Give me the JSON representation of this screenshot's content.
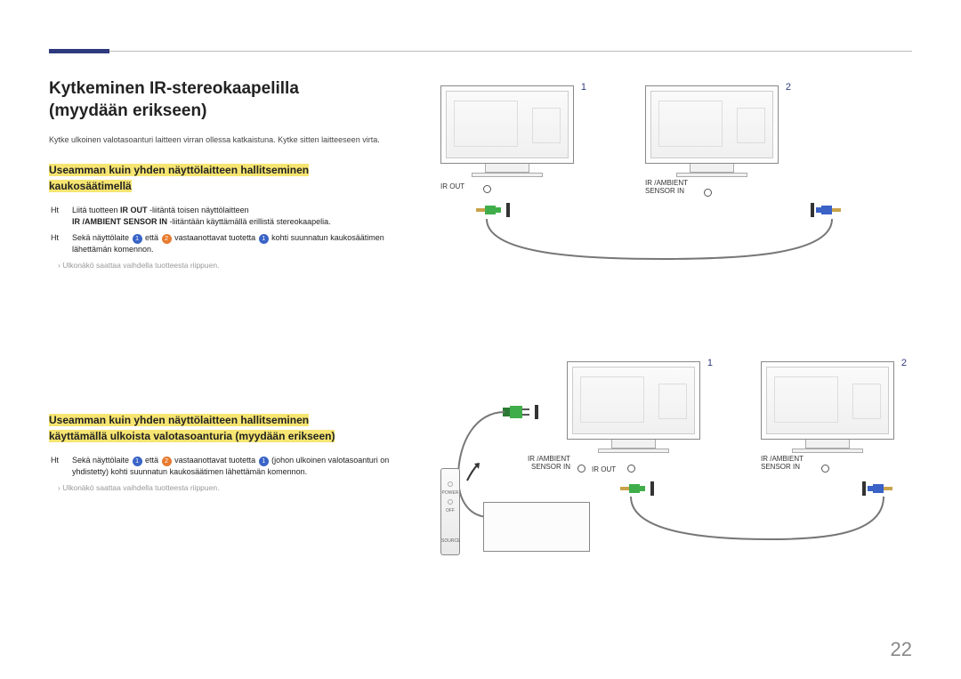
{
  "header": {
    "title_line1": "Kytkeminen IR-stereokaapelilla",
    "title_line2": "(myydään erikseen)"
  },
  "intro": "Kytke ulkoinen valotasoanturi laitteen virran ollessa katkaistuna. Kytke sitten laitteeseen virta.",
  "section1": {
    "heading_l1": "Useamman kuin yhden näyttölaitteen hallitseminen",
    "heading_l2": "kaukosäätimellä",
    "step1_prefix": "Ht",
    "step1_a": "Liitä tuotteen ",
    "step1_bold1": "IR OUT",
    "step1_b": " -liitäntä toisen näyttölaitteen",
    "step1_line2a": "IR /AMBIENT SENSOR IN",
    "step1_line2b": " -liitäntään käyttämällä erillistä stereokaapelia.",
    "step2_prefix": "Ht",
    "step2_a": "Sekä näyttölaite ",
    "step2_b": " että ",
    "step2_c": " vastaanottavat tuotetta ",
    "step2_d": " kohti suunnatun kaukosäätimen lähettämän komennon.",
    "note": "Ulkonäkö saattaa vaihdella tuotteesta riippuen.",
    "badge1": "1",
    "badge2": "2"
  },
  "section2": {
    "heading_l1": "Useamman kuin yhden näyttölaitteen hallitseminen",
    "heading_l2": "käyttämällä ulkoista valotasoanturia (myydään erikseen)",
    "step1_prefix": "Ht",
    "step1_a": "Sekä näyttölaite ",
    "step1_b": " että ",
    "step1_c": " vastaanottavat tuotetta ",
    "step1_d": " (johon ulkoinen valotasoanturi on yhdistetty) kohti suunnatun kaukosäätimen lähettämän komennon.",
    "note": "Ulkonäkö saattaa vaihdella tuotteesta riippuen.",
    "badge1": "1",
    "badge2": "2"
  },
  "diagram": {
    "num1": "1",
    "num2": "2",
    "ir_out": "IR OUT",
    "ir_ambient_l1": "IR /AMBIENT",
    "ir_ambient_l2": "SENSOR IN",
    "remote_power": "POWER",
    "remote_off": "OFF",
    "remote_source": "SOURCE"
  },
  "page_number": "22"
}
